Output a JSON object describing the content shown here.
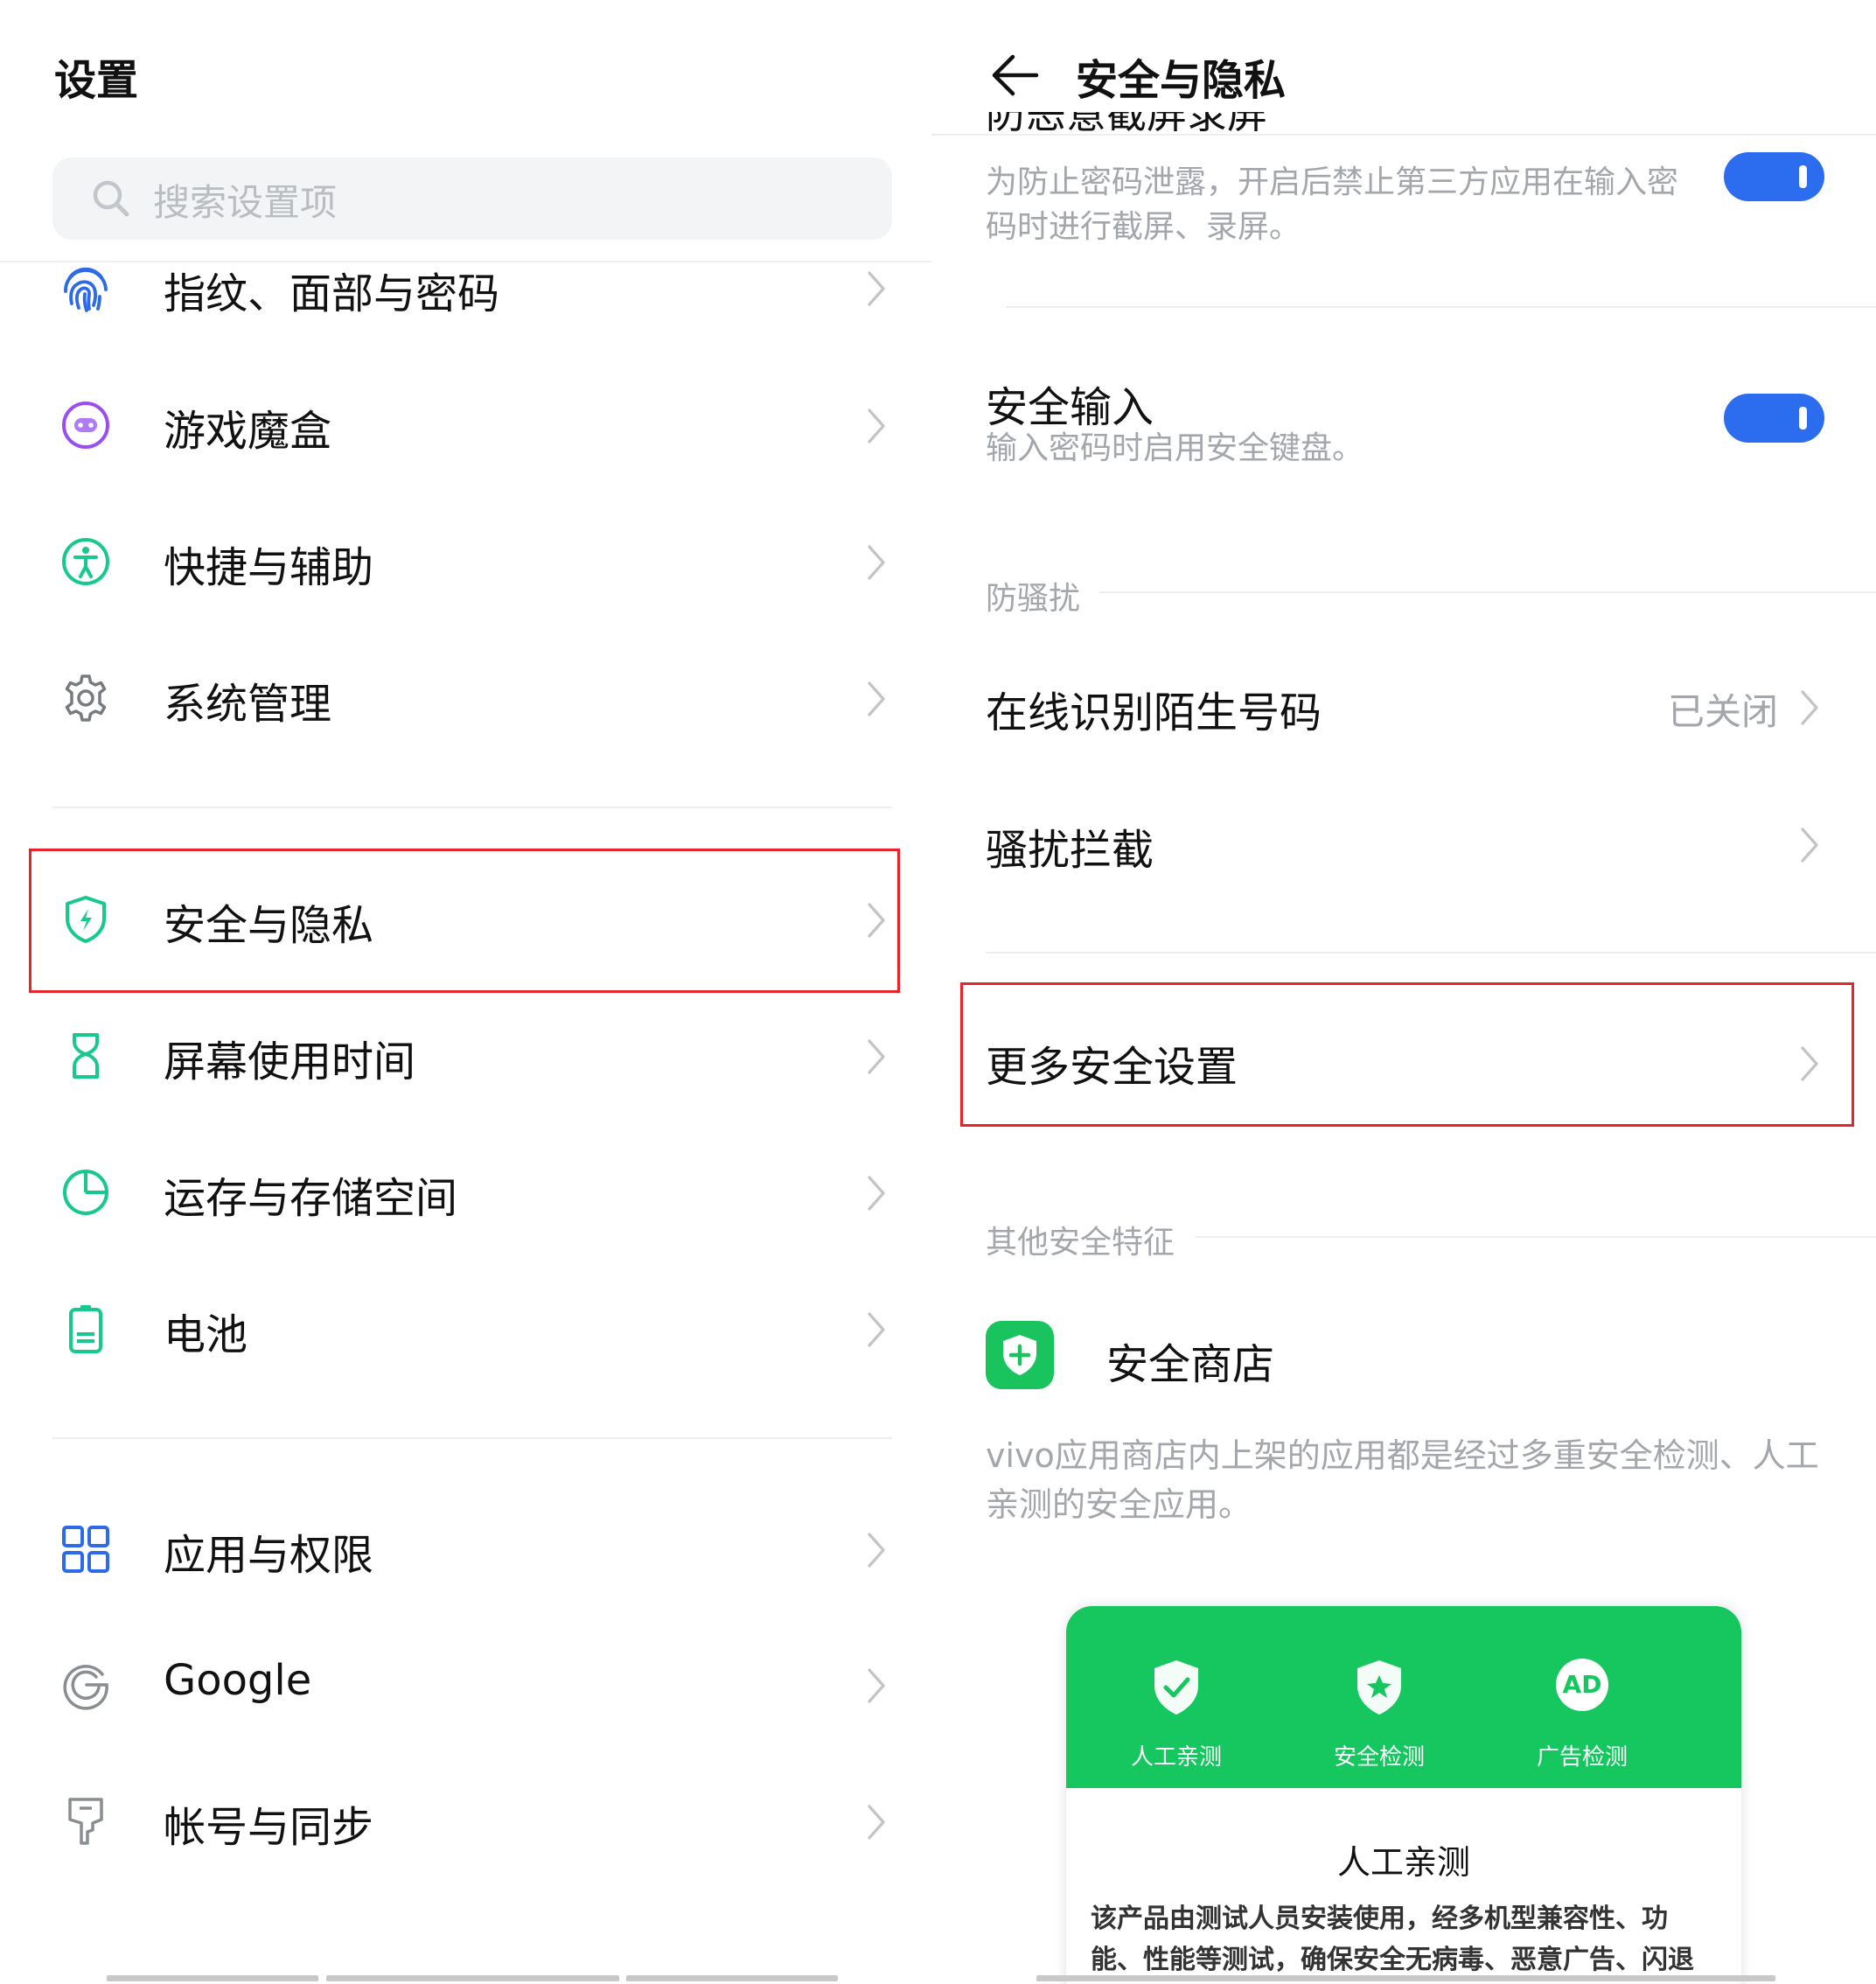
{
  "left": {
    "title": "设置",
    "search_placeholder": "搜索设置项",
    "items": [
      {
        "label": "指纹、面部与密码",
        "icon": "fingerprint-icon"
      },
      {
        "label": "游戏魔盒",
        "icon": "game-box-icon"
      },
      {
        "label": "快捷与辅助",
        "icon": "accessibility-icon"
      },
      {
        "label": "系统管理",
        "icon": "gear-icon"
      },
      {
        "label": "安全与隐私",
        "icon": "shield-icon"
      },
      {
        "label": "屏幕使用时间",
        "icon": "hourglass-icon"
      },
      {
        "label": "运存与存储空间",
        "icon": "pie-chart-icon"
      },
      {
        "label": "电池",
        "icon": "battery-icon"
      },
      {
        "label": "应用与权限",
        "icon": "apps-grid-icon"
      },
      {
        "label": "Google",
        "icon": "google-icon"
      },
      {
        "label": "帐号与同步",
        "icon": "account-sync-icon"
      }
    ]
  },
  "right": {
    "title": "安全与隐私",
    "clipped_title": "防恶意截屏录屏",
    "anti_capture_desc": "为防止密码泄露，开启后禁止第三方应用在输入密码时进行截屏、录屏。",
    "anti_capture_on": true,
    "secure_input_label": "安全输入",
    "secure_input_desc": "输入密码时启用安全键盘。",
    "secure_input_on": true,
    "section_harass": "防骚扰",
    "online_id_label": "在线识别陌生号码",
    "online_id_value": "已关闭",
    "harass_block_label": "骚扰拦截",
    "more_security_label": "更多安全设置",
    "section_other": "其他安全特征",
    "store_label": "安全商店",
    "store_desc": "vivo应用商店内上架的应用都是经过多重安全检测、人工亲测的安全应用。",
    "card": {
      "features": [
        "人工亲测",
        "安全检测",
        "广告检测"
      ],
      "ad_badge": "AD",
      "title": "人工亲测",
      "body": "该产品由测试人员安装使用，经多机型兼容性、功能、性能等测试，确保安全无病毒、恶意广告、闪退"
    }
  },
  "colors": {
    "accent_blue": "#2c6df0",
    "highlight_red": "#e8242a",
    "store_green": "#19c35e"
  }
}
